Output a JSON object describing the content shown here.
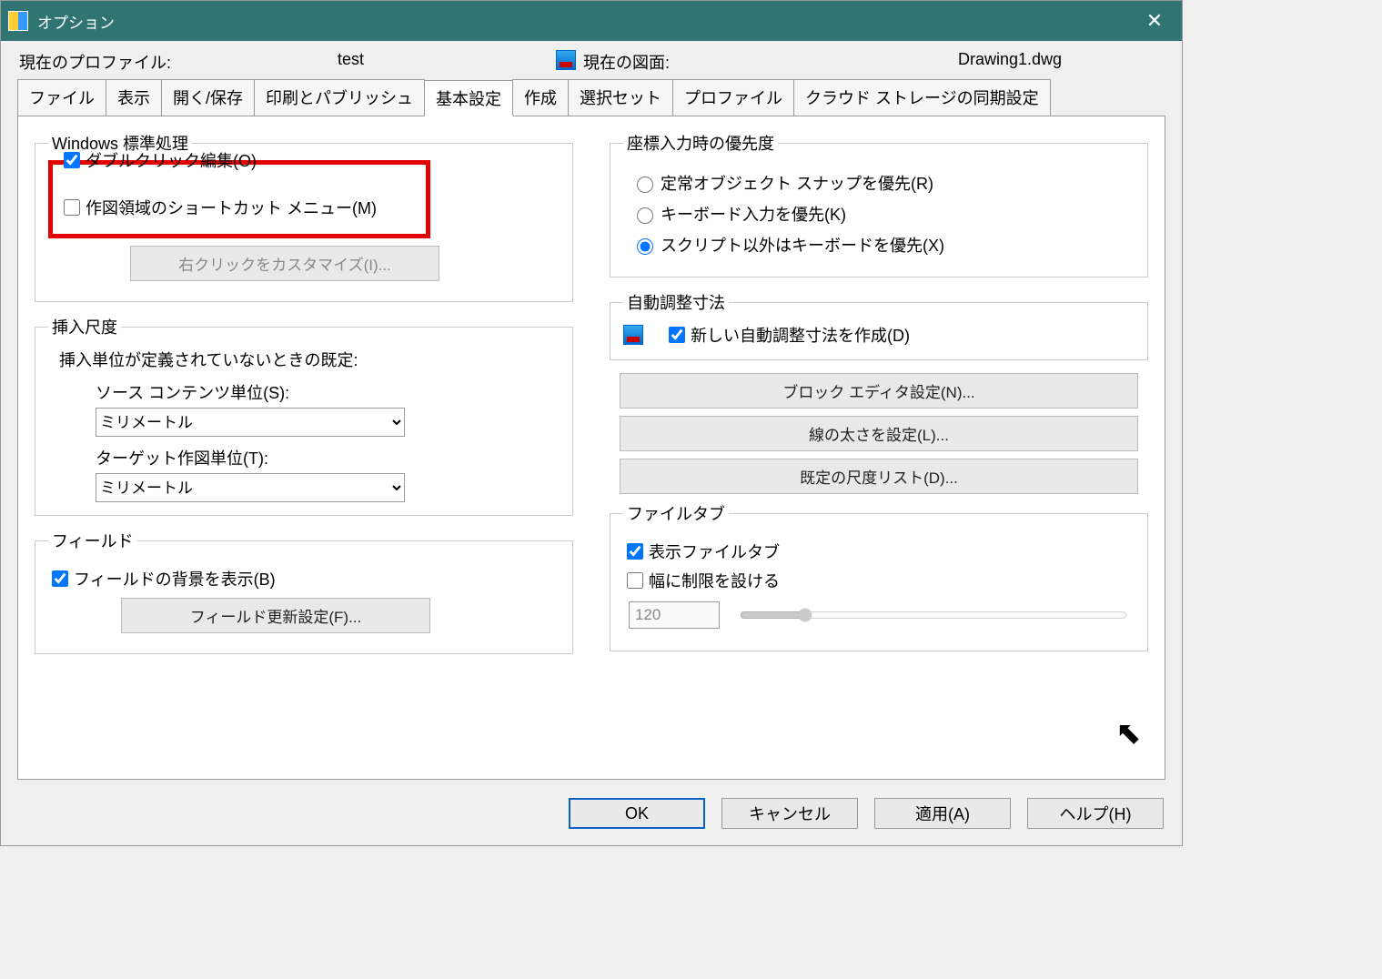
{
  "titlebar": {
    "title": "オプション"
  },
  "header": {
    "profile_label": "現在のプロファイル:",
    "profile_value": "test",
    "drawing_label": "現在の図面:",
    "drawing_value": "Drawing1.dwg"
  },
  "tabs": {
    "t0": "ファイル",
    "t1": "表示",
    "t2": "開く/保存",
    "t3": "印刷とパブリッシュ",
    "t4": "基本設定",
    "t5": "作成",
    "t6": "選択セット",
    "t7": "プロファイル",
    "t8": "クラウド ストレージの同期設定"
  },
  "windows_std": {
    "legend": "Windows 標準処理",
    "dblclick": "ダブルクリック編集(O)",
    "shortcut_menu": "作図領域のショートカット メニュー(M)",
    "rclick_customize": "右クリックをカスタマイズ(I)..."
  },
  "insert_scale": {
    "legend": "挿入尺度",
    "desc": "挿入単位が定義されていないときの既定:",
    "src_label": "ソース コンテンツ単位(S):",
    "src_value": "ミリメートル",
    "tgt_label": "ターゲット作図単位(T):",
    "tgt_value": "ミリメートル"
  },
  "field": {
    "legend": "フィールド",
    "show_bg": "フィールドの背景を表示(B)",
    "update_btn": "フィールド更新設定(F)..."
  },
  "coord_priority": {
    "legend": "座標入力時の優先度",
    "r0": "定常オブジェクト スナップを優先(R)",
    "r1": "キーボード入力を優先(K)",
    "r2": "スクリプト以外はキーボードを優先(X)"
  },
  "auto_dim": {
    "legend": "自動調整寸法",
    "make_new": "新しい自動調整寸法を作成(D)"
  },
  "right_buttons": {
    "block_editor": "ブロック エディタ設定(N)...",
    "lineweight": "線の太さを設定(L)...",
    "scale_list": "既定の尺度リスト(D)..."
  },
  "file_tab": {
    "legend": "ファイルタブ",
    "show": "表示ファイルタブ",
    "limit_width": "幅に制限を設ける",
    "width_value": "120"
  },
  "footer": {
    "ok": "OK",
    "cancel": "キャンセル",
    "apply": "適用(A)",
    "help": "ヘルプ(H)"
  }
}
